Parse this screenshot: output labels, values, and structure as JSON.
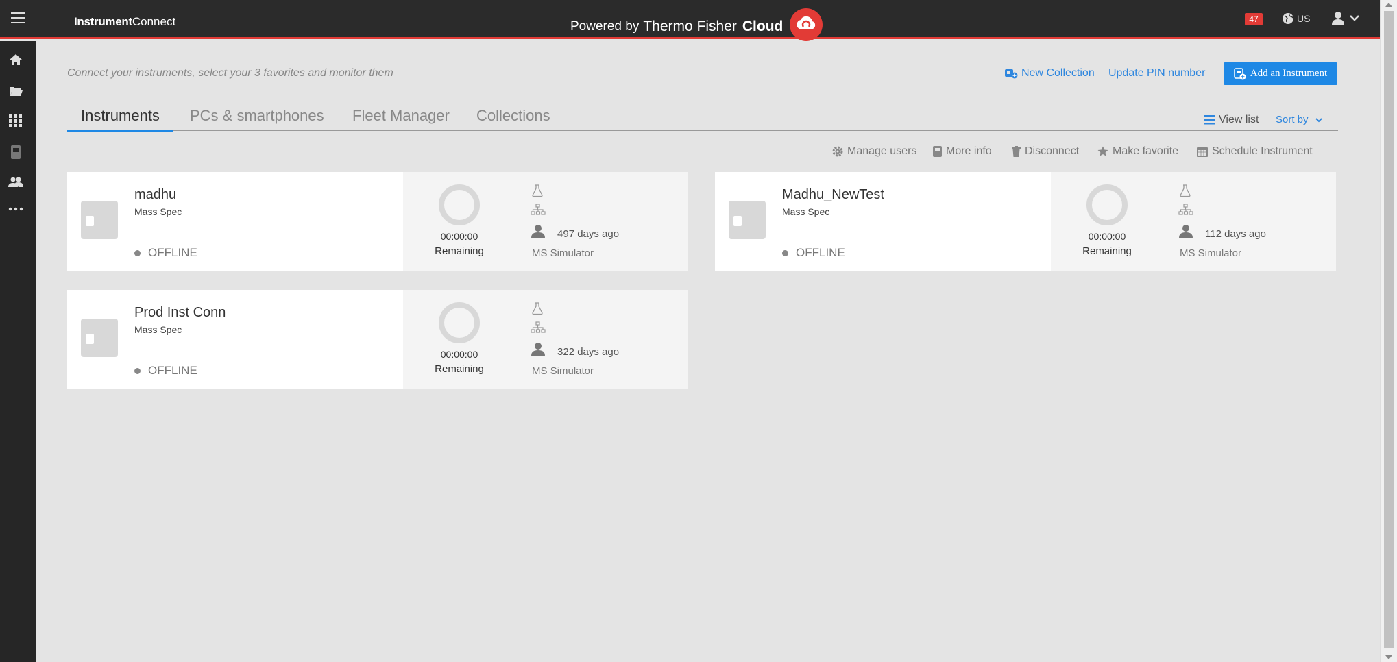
{
  "topbar": {
    "brand_bold": "Instrument",
    "brand_rest": "Connect",
    "powered_prefix": "Powered by",
    "powered_brand": "Thermo Fisher",
    "powered_cloud": "Cloud",
    "notification_count": "47",
    "region": "US",
    "accent_color": "#e23b36"
  },
  "rail": {
    "icons": [
      "home-icon",
      "folder-icon",
      "apps-grid-icon",
      "instrument-icon",
      "users-icon",
      "more-icon"
    ]
  },
  "header": {
    "subtitle": "Connect your instruments, select your 3 favorites and monitor them",
    "new_collection": "New Collection",
    "update_pin": "Update PIN number",
    "add_instrument": "Add an Instrument"
  },
  "tabs": {
    "items": [
      "Instruments",
      "PCs & smartphones",
      "Fleet Manager",
      "Collections"
    ],
    "active": "Instruments",
    "view_list": "View list",
    "sort_by": "Sort by"
  },
  "toolbar": {
    "manage_users": "Manage users",
    "more_info": "More info",
    "disconnect": "Disconnect",
    "make_favorite": "Make favorite",
    "schedule": "Schedule Instrument"
  },
  "instruments": [
    {
      "name": "madhu",
      "type": "Mass Spec",
      "status": "OFFLINE",
      "timer": "00:00:00",
      "remaining": "Remaining",
      "last_seen": "497 days ago",
      "simulator": "MS Simulator"
    },
    {
      "name": "Madhu_NewTest",
      "type": "Mass Spec",
      "status": "OFFLINE",
      "timer": "00:00:00",
      "remaining": "Remaining",
      "last_seen": "112 days ago",
      "simulator": "MS Simulator"
    },
    {
      "name": "Prod Inst Conn",
      "type": "Mass Spec",
      "status": "OFFLINE",
      "timer": "00:00:00",
      "remaining": "Remaining",
      "last_seen": "322 days ago",
      "simulator": "MS Simulator"
    }
  ]
}
